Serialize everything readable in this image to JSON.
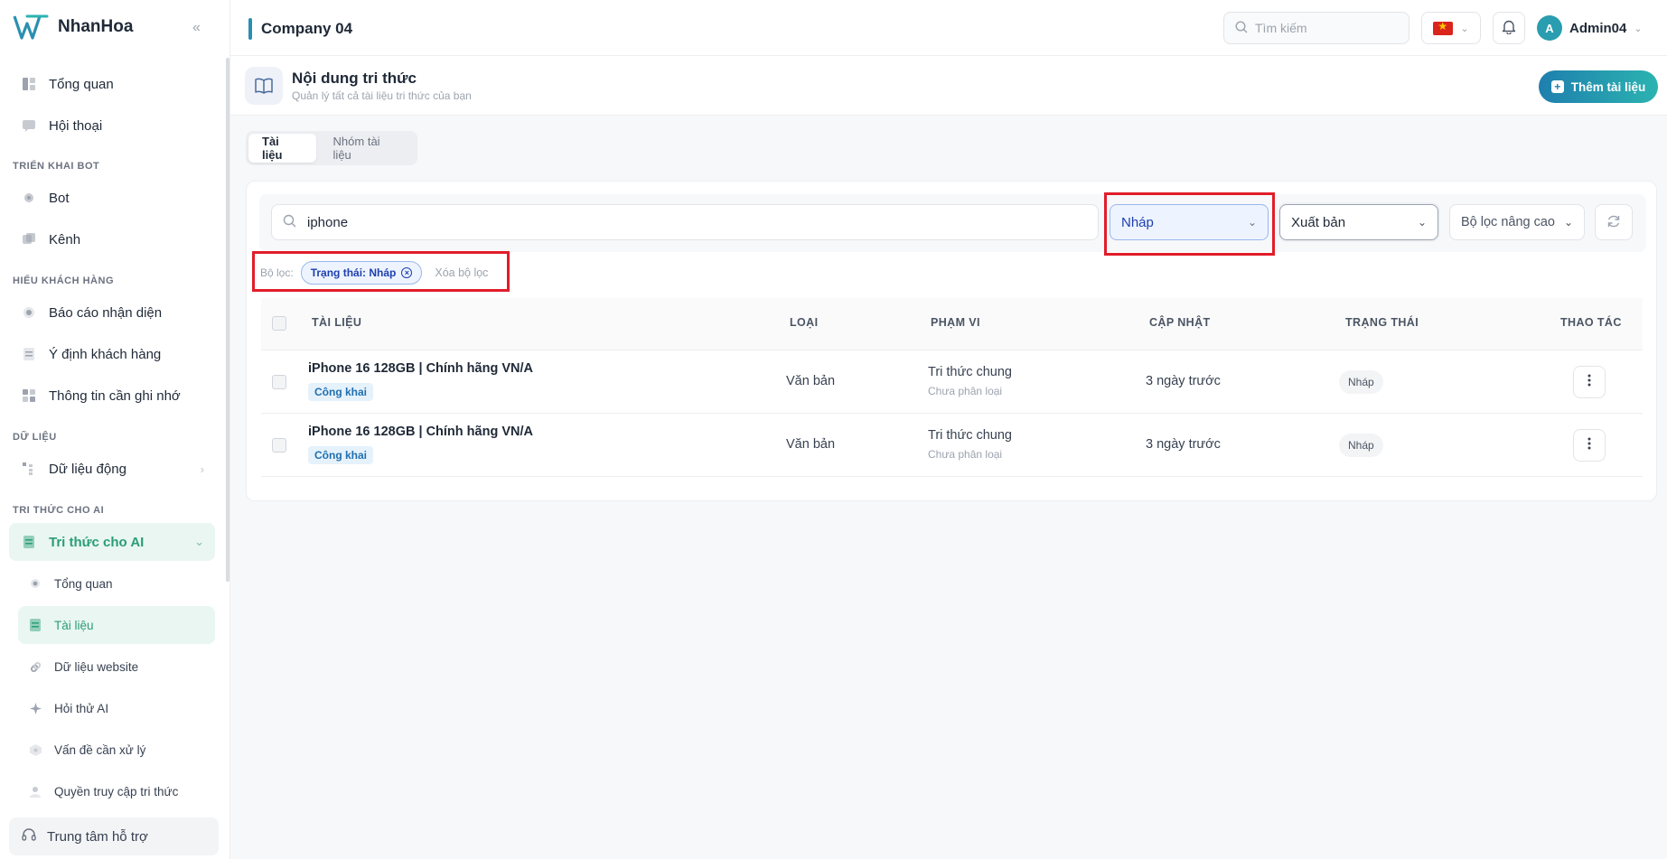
{
  "app": {
    "brand": "NhanHoa",
    "company": "Company 04"
  },
  "sidebar": {
    "items": [
      {
        "label": "Tổng quan",
        "icon": "dashboard-icon"
      },
      {
        "label": "Hội thoại",
        "icon": "chat-icon"
      }
    ],
    "sections": {
      "deploy": "TRIỂN KHAI BOT",
      "customer": "HIỂU KHÁCH HÀNG",
      "data": "DỮ LIỆU",
      "ai": "TRI THỨC CHO AI"
    },
    "deploy_items": [
      {
        "label": "Bot",
        "icon": "bot-icon"
      },
      {
        "label": "Kênh",
        "icon": "channel-icon"
      }
    ],
    "customer_items": [
      {
        "label": "Báo cáo nhận diện",
        "icon": "report-icon"
      },
      {
        "label": "Ý định khách hàng",
        "icon": "intent-icon"
      },
      {
        "label": "Thông tin cần ghi nhớ",
        "icon": "memory-icon"
      }
    ],
    "data_items": [
      {
        "label": "Dữ liệu động",
        "icon": "dynamic-data-icon"
      }
    ],
    "ai_parent": {
      "label": "Tri thức cho AI",
      "icon": "knowledge-icon"
    },
    "ai_items": [
      {
        "label": "Tổng quan",
        "icon": "overview-icon"
      },
      {
        "label": "Tài liệu",
        "icon": "document-icon"
      },
      {
        "label": "Dữ liệu website",
        "icon": "link-icon"
      },
      {
        "label": "Hỏi thử AI",
        "icon": "sparkle-icon"
      },
      {
        "label": "Vấn đề cần xử lý",
        "icon": "issue-icon"
      },
      {
        "label": "Quyền truy cập tri thức",
        "icon": "access-icon"
      }
    ],
    "support": "Trung tâm hỗ trợ"
  },
  "header": {
    "search_placeholder": "Tìm kiếm",
    "user_initial": "A",
    "user_name": "Admin04"
  },
  "page": {
    "title": "Nội dung tri thức",
    "subtitle": "Quản lý tất cả tài liệu tri thức của bạn",
    "add_button": "Thêm tài liệu"
  },
  "tabs": [
    "Tài liệu",
    "Nhóm tài liệu"
  ],
  "filters": {
    "search_value": "iphone",
    "status": "Nháp",
    "publish": "Xuất bản",
    "advanced": "Bộ lọc nâng cao",
    "filter_label": "Bộ lọc:",
    "chip": "Trạng thái: Nháp",
    "clear": "Xóa bộ lọc"
  },
  "table": {
    "headers": [
      "TÀI LIỆU",
      "LOẠI",
      "PHẠM VI",
      "CẬP NHẬT",
      "TRẠNG THÁI",
      "THAO TÁC"
    ],
    "rows": [
      {
        "title": "iPhone 16 128GB | Chính hãng VN/A",
        "visibility": "Công khai",
        "type": "Văn bản",
        "scope": "Tri thức chung",
        "scope_sub": "Chưa phân loại",
        "updated": "3 ngày trước",
        "status": "Nháp"
      },
      {
        "title": "iPhone 16 128GB | Chính hãng VN/A",
        "visibility": "Công khai",
        "type": "Văn bản",
        "scope": "Tri thức chung",
        "scope_sub": "Chưa phân loại",
        "updated": "3 ngày trước",
        "status": "Nháp"
      }
    ]
  },
  "colors": {
    "accent": "#2a9d78",
    "primary": "#1f7fae",
    "highlight": "#e11d2a"
  }
}
